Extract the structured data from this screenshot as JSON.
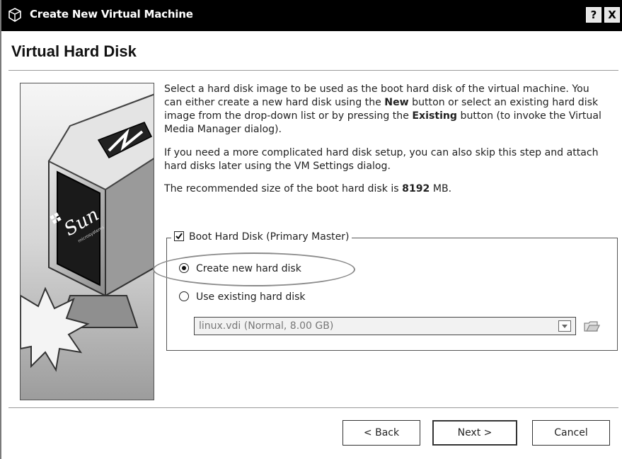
{
  "window": {
    "title": "Create New Virtual Machine",
    "help_label": "?",
    "close_label": "X"
  },
  "page": {
    "heading": "Virtual Hard Disk"
  },
  "instructions": {
    "p1_a": "Select a hard disk image to be used as the boot hard disk of the virtual machine. You can either create a new hard disk using the ",
    "p1_new": "New",
    "p1_b": " button or select an existing hard disk image from the drop-down list or by pressing the ",
    "p1_existing": "Existing",
    "p1_c": " button (to invoke the Virtual Media Manager dialog).",
    "p2": "If you need a more complicated hard disk setup, you can also skip this step and attach hard disks later using the VM Settings dialog.",
    "p3_a": "The recommended size of the boot hard disk is ",
    "p3_size": "8192",
    "p3_unit": " MB."
  },
  "boot_disk": {
    "label": "Boot Hard Disk (Primary Master)",
    "checked": true,
    "create_new_label": "Create new hard disk",
    "create_new_selected": true,
    "use_existing_label": "Use existing hard disk",
    "use_existing_selected": false,
    "existing_selected_value": "linux.vdi (Normal, 8.00 GB)"
  },
  "buttons": {
    "back": "< Back",
    "next": "Next >",
    "cancel": "Cancel"
  },
  "side_image": {
    "logo_text": "Sun",
    "logo_subtext": "microsystems"
  },
  "colors": {
    "titlebar": "#000000",
    "highlight_ellipse": "#8a8a8a"
  },
  "icons": {
    "app": "virtualbox-cube-icon",
    "folder": "open-folder-icon",
    "dropdown": "dropdown-arrow-icon"
  }
}
